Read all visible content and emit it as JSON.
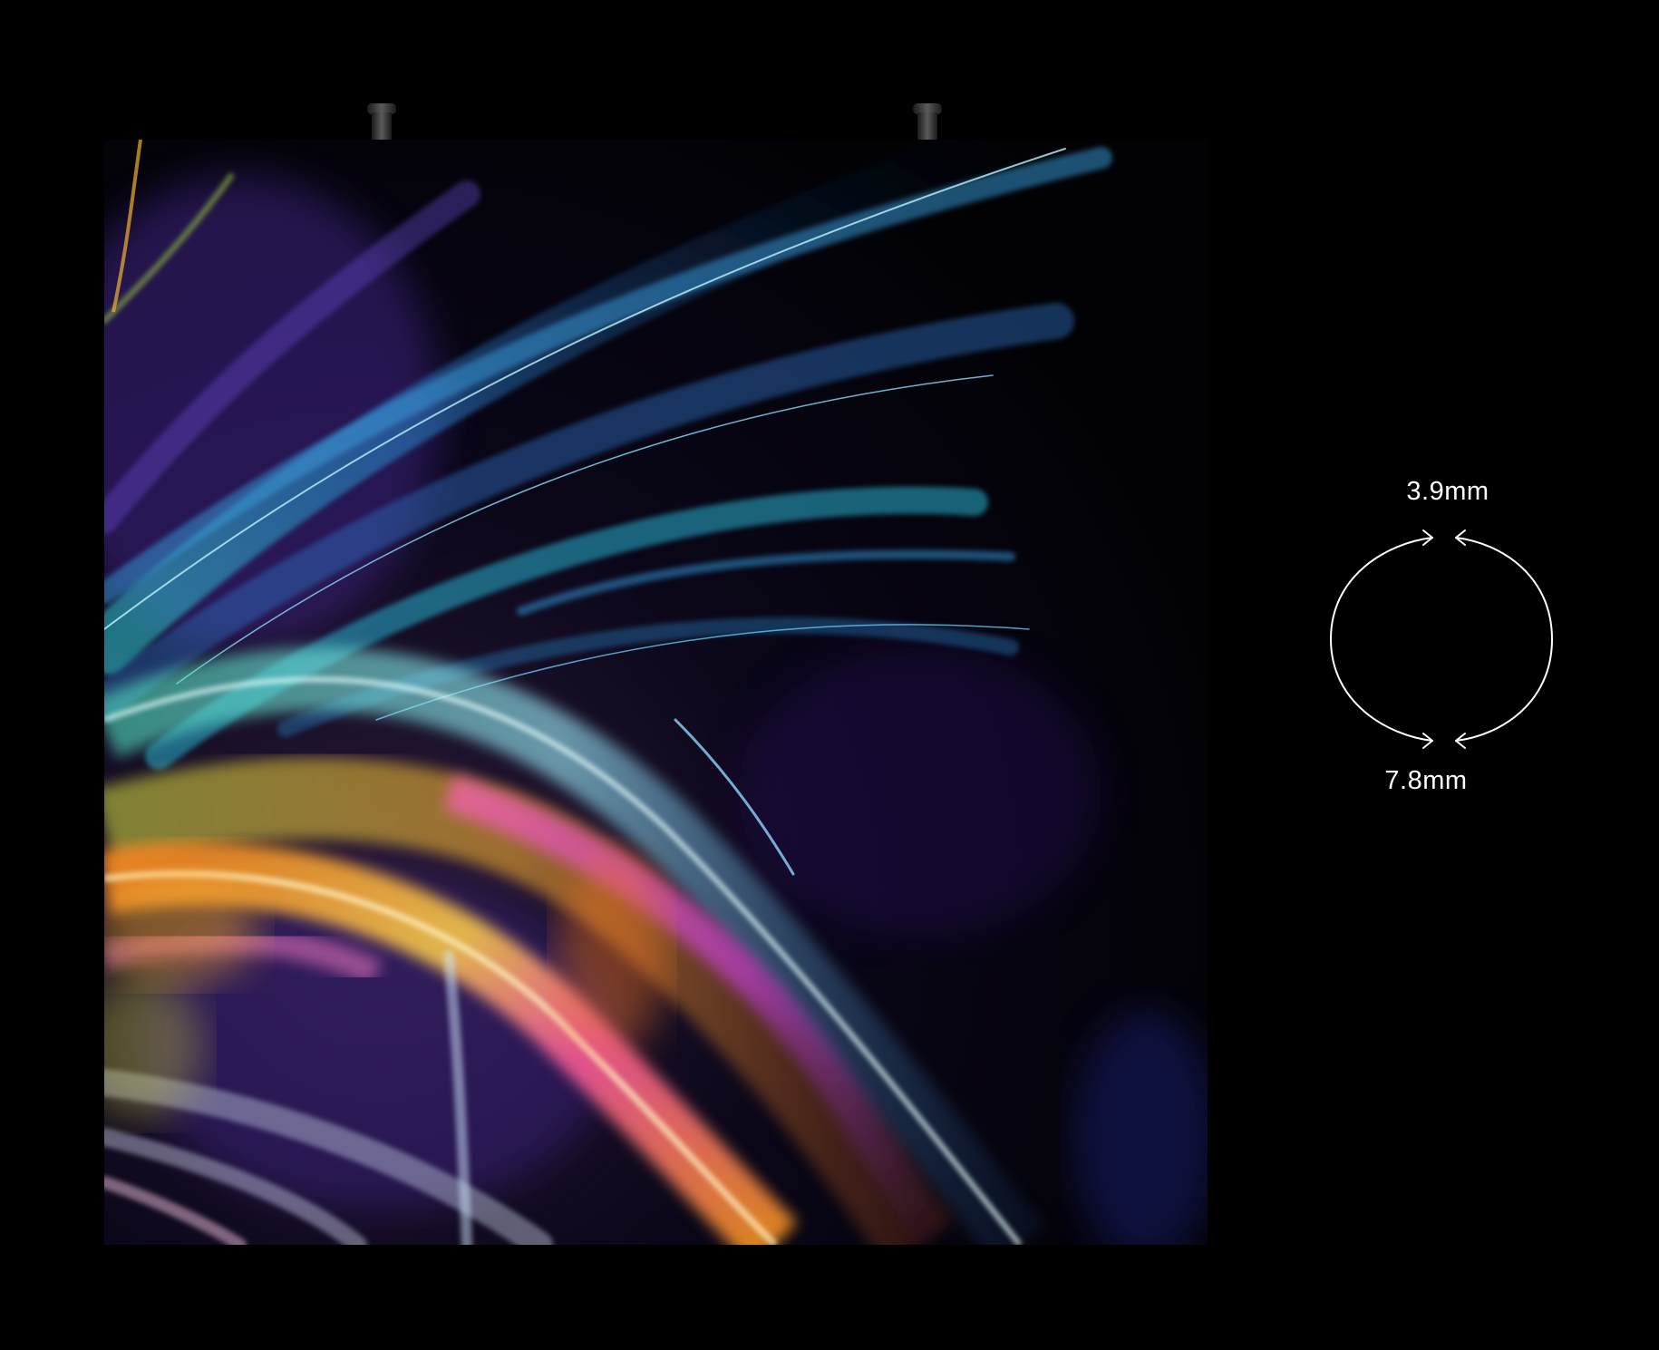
{
  "pitch": {
    "top_label": "3.9mm",
    "bottom_label": "7.8mm"
  },
  "colors": {
    "background": "#000000",
    "label": "#ffffff",
    "diagram_stroke": "#ffffff",
    "panel_hues": [
      "#1b3f8f",
      "#1fb6c9",
      "#f0a018",
      "#e43c8c",
      "#f3e04a",
      "#6a2cb0"
    ]
  },
  "icons": {
    "mount_pins": "cylinder-mount-pin",
    "arrows": "curved-arrow-icon"
  }
}
